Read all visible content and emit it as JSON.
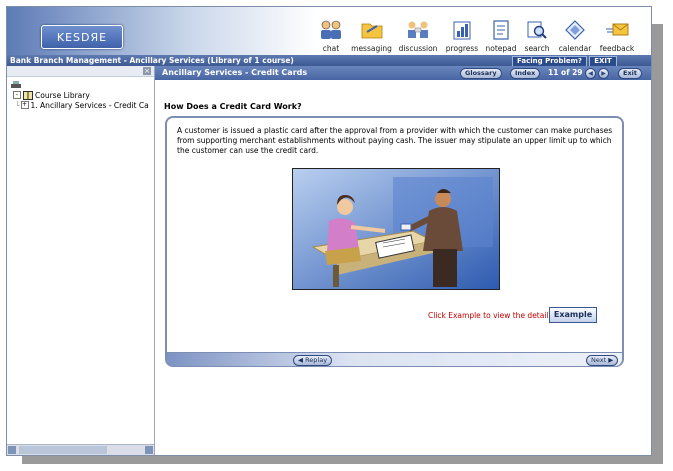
{
  "logo": {
    "text": "KESDЯE"
  },
  "toolbar": [
    {
      "label": "chat",
      "icon": "chat-icon"
    },
    {
      "label": "messaging",
      "icon": "messaging-icon"
    },
    {
      "label": "discussion",
      "icon": "discussion-icon"
    },
    {
      "label": "progress",
      "icon": "progress-icon"
    },
    {
      "label": "notepad",
      "icon": "notepad-icon"
    },
    {
      "label": "search",
      "icon": "search-icon"
    },
    {
      "label": "calendar",
      "icon": "calendar-icon"
    },
    {
      "label": "feedback",
      "icon": "feedback-icon"
    }
  ],
  "titlebar": {
    "text": "Bank Branch Management - Ancillary Services (Library of 1 course)",
    "facing_problem": "Facing Problem?",
    "exit": "EXIT"
  },
  "sidebar": {
    "close": "×",
    "root": "Course Library",
    "item": "1. Ancillary Services - Credit Ca"
  },
  "nav": {
    "title": "Ancillary Services - Credit Cards",
    "glossary": "Glossary",
    "index": "Index",
    "page": "11 of 29",
    "exit": "Exit"
  },
  "content": {
    "heading": "How Does a Credit Card Work?",
    "paragraph": "A customer is issued a plastic card after the approval from a provider with which the customer can make purchases from supporting merchant establishments without paying cash. The issuer may stipulate an upper limit up to which the customer can use the credit card.",
    "example_note": "Click Example to view the details.",
    "example_button": "Example",
    "replay": "Replay",
    "next": "Next"
  },
  "colors": {
    "accent": "#4865a3",
    "note": "#c00000"
  }
}
